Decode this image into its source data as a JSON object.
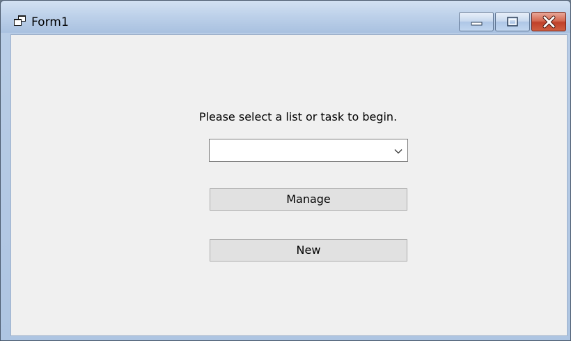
{
  "window": {
    "title": "Form1",
    "icon": "form-window-icon",
    "controls": {
      "minimize_icon": "minimize-icon",
      "maximize_icon": "maximize-icon",
      "close_icon": "close-icon"
    }
  },
  "form": {
    "prompt": "Please select a list or task to begin.",
    "selector": {
      "value": "",
      "arrow_icon": "chevron-down-icon"
    },
    "manage_label": "Manage",
    "new_label": "New"
  },
  "colors": {
    "titlebar": "#bcd0e9",
    "client_background": "#f0f0f0",
    "button_face": "#e1e1e1",
    "close_button": "#c0412a"
  }
}
